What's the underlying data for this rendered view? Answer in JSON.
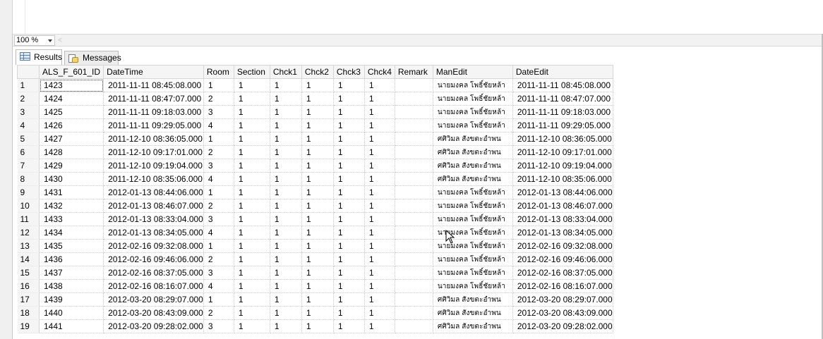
{
  "toolbar": {
    "zoom": "100 %",
    "scroll_left_glyph": "<"
  },
  "tabs": [
    {
      "label": "Results",
      "icon": "grid-icon",
      "active": true
    },
    {
      "label": "Messages",
      "icon": "messages-icon",
      "active": false
    }
  ],
  "grid": {
    "columns": [
      "",
      "ALS_F_601_ID",
      "DateTime",
      "Room",
      "Section",
      "Chck1",
      "Chck2",
      "Chck3",
      "Chck4",
      "Remark",
      "ManEdit",
      "DateEdit"
    ],
    "rows": [
      [
        "1",
        "1423",
        "2011-11-11 08:45:08.000",
        "1",
        "1",
        "1",
        "1",
        "1",
        "1",
        "",
        "นายมงคล โพธิ์ชัยหล้า",
        "2011-11-11 08:45:08.000"
      ],
      [
        "2",
        "1424",
        "2011-11-11 08:47:07.000",
        "2",
        "1",
        "1",
        "1",
        "1",
        "1",
        "",
        "นายมงคล โพธิ์ชัยหล้า",
        "2011-11-11 08:47:07.000"
      ],
      [
        "3",
        "1425",
        "2011-11-11 09:18:03.000",
        "3",
        "1",
        "1",
        "1",
        "1",
        "1",
        "",
        "นายมงคล โพธิ์ชัยหล้า",
        "2011-11-11 09:18:03.000"
      ],
      [
        "4",
        "1426",
        "2011-11-11 09:29:05.000",
        "4",
        "1",
        "1",
        "1",
        "1",
        "1",
        "",
        "นายมงคล โพธิ์ชัยหล้า",
        "2011-11-11 09:29:05.000"
      ],
      [
        "5",
        "1427",
        "2011-12-10 08:36:05.000",
        "1",
        "1",
        "1",
        "1",
        "1",
        "1",
        "",
        "ศศิวิมล สังขตะอำพน",
        "2011-12-10 08:36:05.000"
      ],
      [
        "6",
        "1428",
        "2011-12-10 09:17:01.000",
        "2",
        "1",
        "1",
        "1",
        "1",
        "1",
        "",
        "ศศิวิมล สังขตะอำพน",
        "2011-12-10 09:17:01.000"
      ],
      [
        "7",
        "1429",
        "2011-12-10 09:19:04.000",
        "3",
        "1",
        "1",
        "1",
        "1",
        "1",
        "",
        "ศศิวิมล สังขตะอำพน",
        "2011-12-10 09:19:04.000"
      ],
      [
        "8",
        "1430",
        "2011-12-10 08:35:06.000",
        "4",
        "1",
        "1",
        "1",
        "1",
        "1",
        "",
        "ศศิวิมล สังขตะอำพน",
        "2011-12-10 08:35:06.000"
      ],
      [
        "9",
        "1431",
        "2012-01-13 08:44:06.000",
        "1",
        "1",
        "1",
        "1",
        "1",
        "1",
        "",
        "นายมงคล โพธิ์ชัยหล้า",
        "2012-01-13 08:44:06.000"
      ],
      [
        "10",
        "1432",
        "2012-01-13 08:46:07.000",
        "2",
        "1",
        "1",
        "1",
        "1",
        "1",
        "",
        "นายมงคล โพธิ์ชัยหล้า",
        "2012-01-13 08:46:07.000"
      ],
      [
        "11",
        "1433",
        "2012-01-13 08:33:04.000",
        "3",
        "1",
        "1",
        "1",
        "1",
        "1",
        "",
        "นายมงคล โพธิ์ชัยหล้า",
        "2012-01-13 08:33:04.000"
      ],
      [
        "12",
        "1434",
        "2012-01-13 08:34:05.000",
        "4",
        "1",
        "1",
        "1",
        "1",
        "1",
        "",
        "นายมงคล โพธิ์ชัยหล้า",
        "2012-01-13 08:34:05.000"
      ],
      [
        "13",
        "1435",
        "2012-02-16 09:32:08.000",
        "1",
        "1",
        "1",
        "1",
        "1",
        "1",
        "",
        "นายมงคล โพธิ์ชัยหล้า",
        "2012-02-16 09:32:08.000"
      ],
      [
        "14",
        "1436",
        "2012-02-16 09:46:06.000",
        "2",
        "1",
        "1",
        "1",
        "1",
        "1",
        "",
        "นายมงคล โพธิ์ชัยหล้า",
        "2012-02-16 09:46:06.000"
      ],
      [
        "15",
        "1437",
        "2012-02-16 08:37:05.000",
        "3",
        "1",
        "1",
        "1",
        "1",
        "1",
        "",
        "นายมงคล โพธิ์ชัยหล้า",
        "2012-02-16 08:37:05.000"
      ],
      [
        "16",
        "1438",
        "2012-02-16 08:16:07.000",
        "4",
        "1",
        "1",
        "1",
        "1",
        "1",
        "",
        "นายมงคล โพธิ์ชัยหล้า",
        "2012-02-16 08:16:07.000"
      ],
      [
        "17",
        "1439",
        "2012-03-20 08:29:07.000",
        "1",
        "1",
        "1",
        "1",
        "1",
        "1",
        "",
        "ศศิวิมล สังขตะอำพน",
        "2012-03-20 08:29:07.000"
      ],
      [
        "18",
        "1440",
        "2012-03-20 08:43:09.000",
        "2",
        "1",
        "1",
        "1",
        "1",
        "1",
        "",
        "ศศิวิมล สังขตะอำพน",
        "2012-03-20 08:43:09.000"
      ],
      [
        "19",
        "1441",
        "2012-03-20 09:28:02.000",
        "3",
        "1",
        "1",
        "1",
        "1",
        "1",
        "",
        "ศศิวิมล สังขตะอำพน",
        "2012-03-20 09:28:02.000"
      ]
    ]
  }
}
